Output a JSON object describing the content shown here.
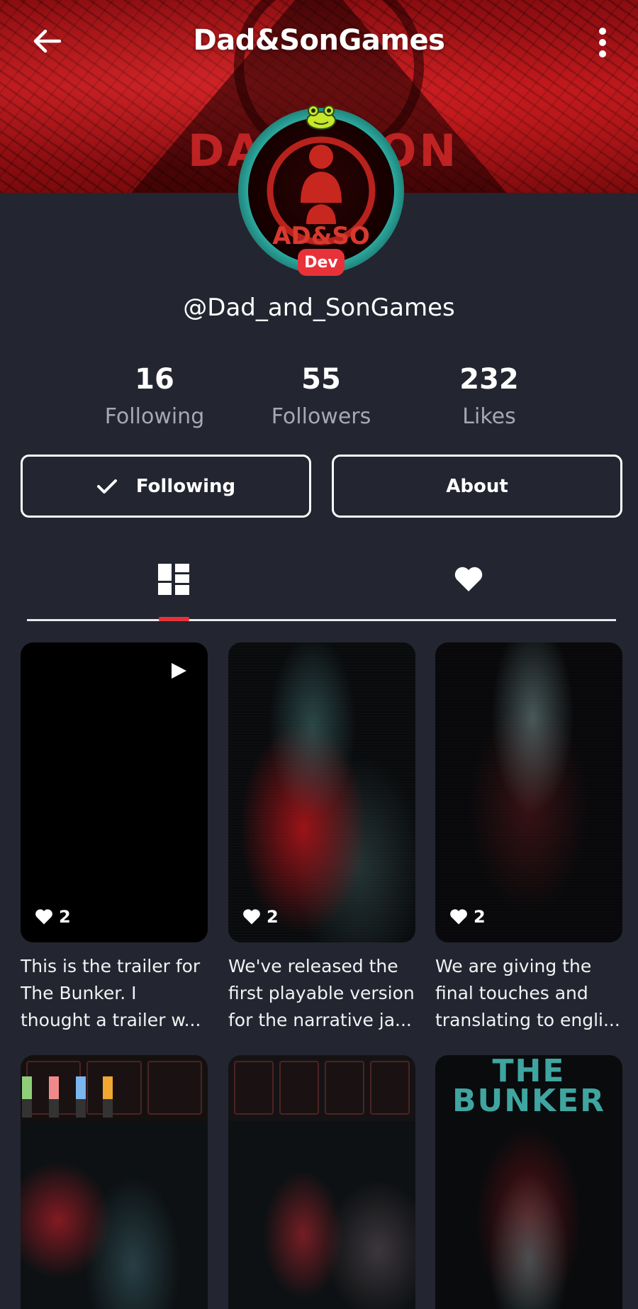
{
  "header": {
    "title": "Dad&SonGames",
    "banner_text": "DAD&SON"
  },
  "profile": {
    "username": "@Dad_and_SonGames",
    "badge": "Dev",
    "avatar_text": "AD&SO"
  },
  "stats": [
    {
      "value": "16",
      "label": "Following"
    },
    {
      "value": "55",
      "label": "Followers"
    },
    {
      "value": "232",
      "label": "Likes"
    }
  ],
  "actions": {
    "following_label": "Following",
    "about_label": "About"
  },
  "tabs": [
    {
      "icon": "grid-icon",
      "active": true
    },
    {
      "icon": "heart-icon",
      "active": false
    }
  ],
  "posts": [
    {
      "likes": "2",
      "caption_lines": [
        "This is the trailer for",
        "The Bunker. I",
        "thought a trailer w..."
      ],
      "is_video": true
    },
    {
      "likes": "2",
      "caption_lines": [
        "We've released the",
        "first playable version",
        "for the narrative ja..."
      ]
    },
    {
      "likes": "2",
      "caption_lines": [
        "We are giving the",
        "final touches and",
        "translating to engli..."
      ]
    },
    {
      "thumb": "screenshot-panels"
    },
    {
      "thumb": "screenshot-panels"
    },
    {
      "thumb_text": "THE BUNKER"
    }
  ],
  "colors": {
    "background": "#232630",
    "accent": "#e8323a",
    "banner": "#b3161a",
    "avatar_ring": "#2fb3a6",
    "muted_text": "#a6a9b2"
  }
}
